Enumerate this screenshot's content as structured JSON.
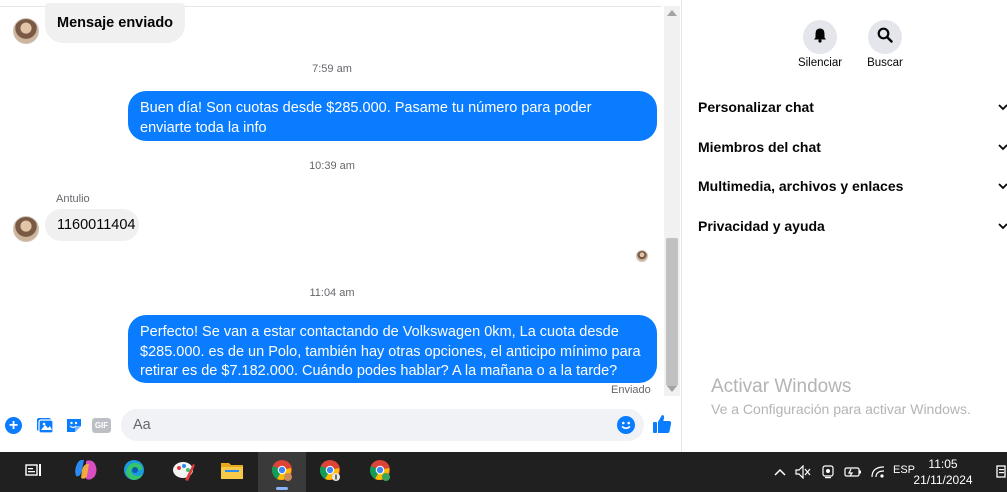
{
  "chat": {
    "messages": {
      "m1": "Mensaje enviado",
      "t1": "7:59 am",
      "m2": "Buen día! Son cuotas desde $285.000. Pasame tu número para poder enviarte toda la info",
      "t2": "10:39 am",
      "sender": "Antulio",
      "m3": "1160011404",
      "t3": "11:04 am",
      "m4": "Perfecto!  Se van a estar contactando de Volkswagen 0km, La cuota desde $285.000. es de un Polo, también hay otras opciones, el anticipo mínimo para retirar es de $7.182.000. Cuándo podes hablar? A la mañana o a la tarde?",
      "status": "Enviado"
    },
    "composer": {
      "placeholder": "Aa",
      "gif_label": "GIF"
    }
  },
  "info": {
    "mute_label": "Silenciar",
    "search_label": "Buscar",
    "sections": [
      "Personalizar chat",
      "Miembros del chat",
      "Multimedia, archivos y enlaces",
      "Privacidad y ayuda"
    ]
  },
  "watermark": {
    "title": "Activar Windows",
    "subtitle": "Ve a Configuración para activar Windows."
  },
  "taskbar": {
    "language": "ESP",
    "time": "11:05",
    "date": "21/11/2024"
  },
  "colors": {
    "accent": "#0a7cff",
    "incoming_bubble": "#f0f0f0",
    "taskbar": "#202020"
  }
}
